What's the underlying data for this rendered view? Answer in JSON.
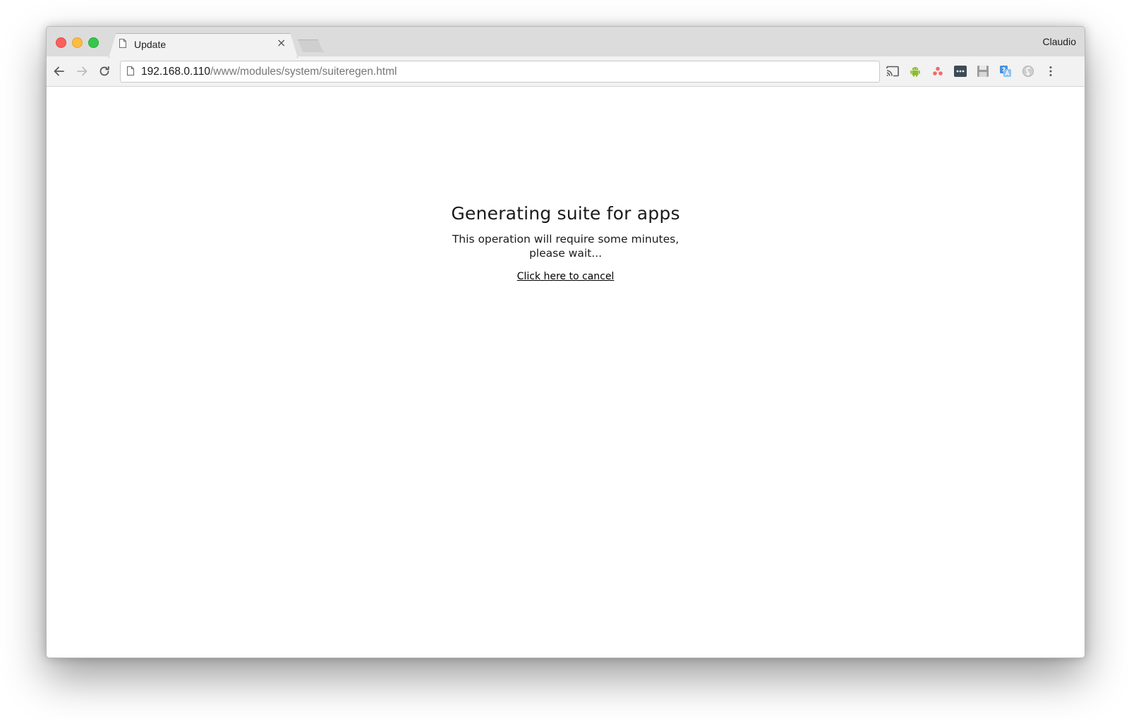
{
  "window": {
    "traffic_lights": {
      "close_color": "#fc605c",
      "minimize_color": "#fdbc40",
      "maximize_color": "#34c84a"
    },
    "profile_name": "Claudio"
  },
  "tabs": [
    {
      "title": "Update",
      "icon": "page-icon",
      "close_label": "×",
      "active": true
    }
  ],
  "toolbar": {
    "back_icon": "back-arrow-icon",
    "forward_icon": "forward-arrow-icon",
    "reload_icon": "reload-icon",
    "address": {
      "host": "192.168.0.110",
      "path": "/www/modules/system/suiteregen.html"
    },
    "extensions": [
      "cast-icon",
      "android-icon",
      "asana-icon",
      "password-manager-icon",
      "save-icon",
      "translate-icon",
      "grey-extension-icon",
      "menu-kebab-icon"
    ]
  },
  "page": {
    "heading": "Generating suite for apps",
    "message_line1": "This operation will require some minutes,",
    "message_line2": "please wait...",
    "cancel_link": "Click here to cancel"
  }
}
